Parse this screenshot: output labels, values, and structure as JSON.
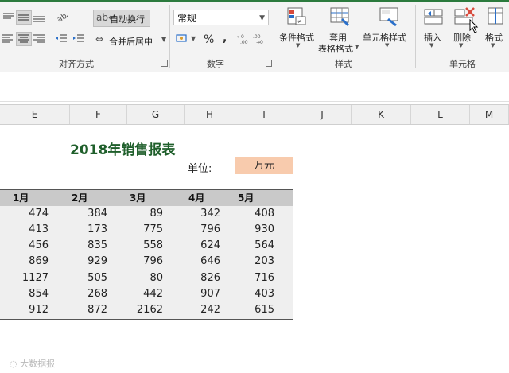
{
  "ribbon": {
    "alignment": {
      "wrap_text": "自动换行",
      "merge_center": "合并后居中",
      "group_label": "对齐方式"
    },
    "number": {
      "format_value": "常规",
      "percent": "%",
      "comma": ",",
      "group_label": "数字"
    },
    "styles": {
      "conditional_format": "条件格式",
      "table_format_line1": "套用",
      "table_format_line2": "表格格式",
      "cell_styles": "单元格样式",
      "group_label": "样式"
    },
    "cells": {
      "insert": "插入",
      "delete": "删除",
      "format": "格式",
      "group_label": "单元格"
    }
  },
  "columns": [
    "E",
    "F",
    "G",
    "H",
    "I",
    "J",
    "K",
    "L",
    "M"
  ],
  "sheet": {
    "title": "2018年销售报表",
    "unit_label": "单位:",
    "unit_value": "万元",
    "headers": [
      "1月",
      "2月",
      "3月",
      "4月",
      "5月"
    ],
    "rows": [
      [
        "474",
        "384",
        "89",
        "342",
        "408"
      ],
      [
        "413",
        "173",
        "775",
        "796",
        "930"
      ],
      [
        "456",
        "835",
        "558",
        "624",
        "564"
      ],
      [
        "869",
        "929",
        "796",
        "646",
        "203"
      ],
      [
        "1127",
        "505",
        "80",
        "826",
        "716"
      ],
      [
        "854",
        "268",
        "442",
        "907",
        "403"
      ],
      [
        "912",
        "872",
        "2162",
        "242",
        "615"
      ]
    ]
  },
  "watermark": "大数据报",
  "colors": {
    "title": "#1f5f2b",
    "unit_fill": "#f8cbad",
    "header_fill": "#c9c9c9",
    "body_fill": "#efefef"
  }
}
